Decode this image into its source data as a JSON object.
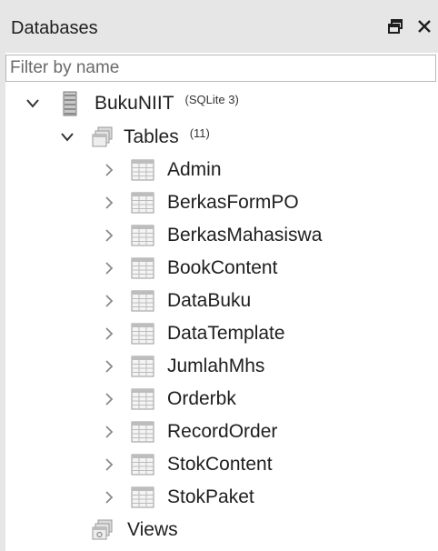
{
  "panel": {
    "title": "Databases",
    "float_icon": "float-window-icon",
    "close_icon": "close-icon"
  },
  "filter": {
    "placeholder": "Filter by name",
    "value": ""
  },
  "tree": {
    "database": {
      "name": "BukuNIIT",
      "type": "(SQLite 3)",
      "icon": "database-icon",
      "expanded": true
    },
    "tables_folder": {
      "label": "Tables",
      "count": "(11)",
      "icon": "tables-folder-icon",
      "expanded": true
    },
    "tables": [
      {
        "name": "Admin"
      },
      {
        "name": "BerkasFormPO"
      },
      {
        "name": "BerkasMahasiswa"
      },
      {
        "name": "BookContent"
      },
      {
        "name": "DataBuku"
      },
      {
        "name": "DataTemplate"
      },
      {
        "name": "JumlahMhs"
      },
      {
        "name": "Orderbk"
      },
      {
        "name": "RecordOrder"
      },
      {
        "name": "StokContent"
      },
      {
        "name": "StokPaket"
      }
    ],
    "views_folder": {
      "label": "Views",
      "icon": "views-folder-icon"
    }
  }
}
